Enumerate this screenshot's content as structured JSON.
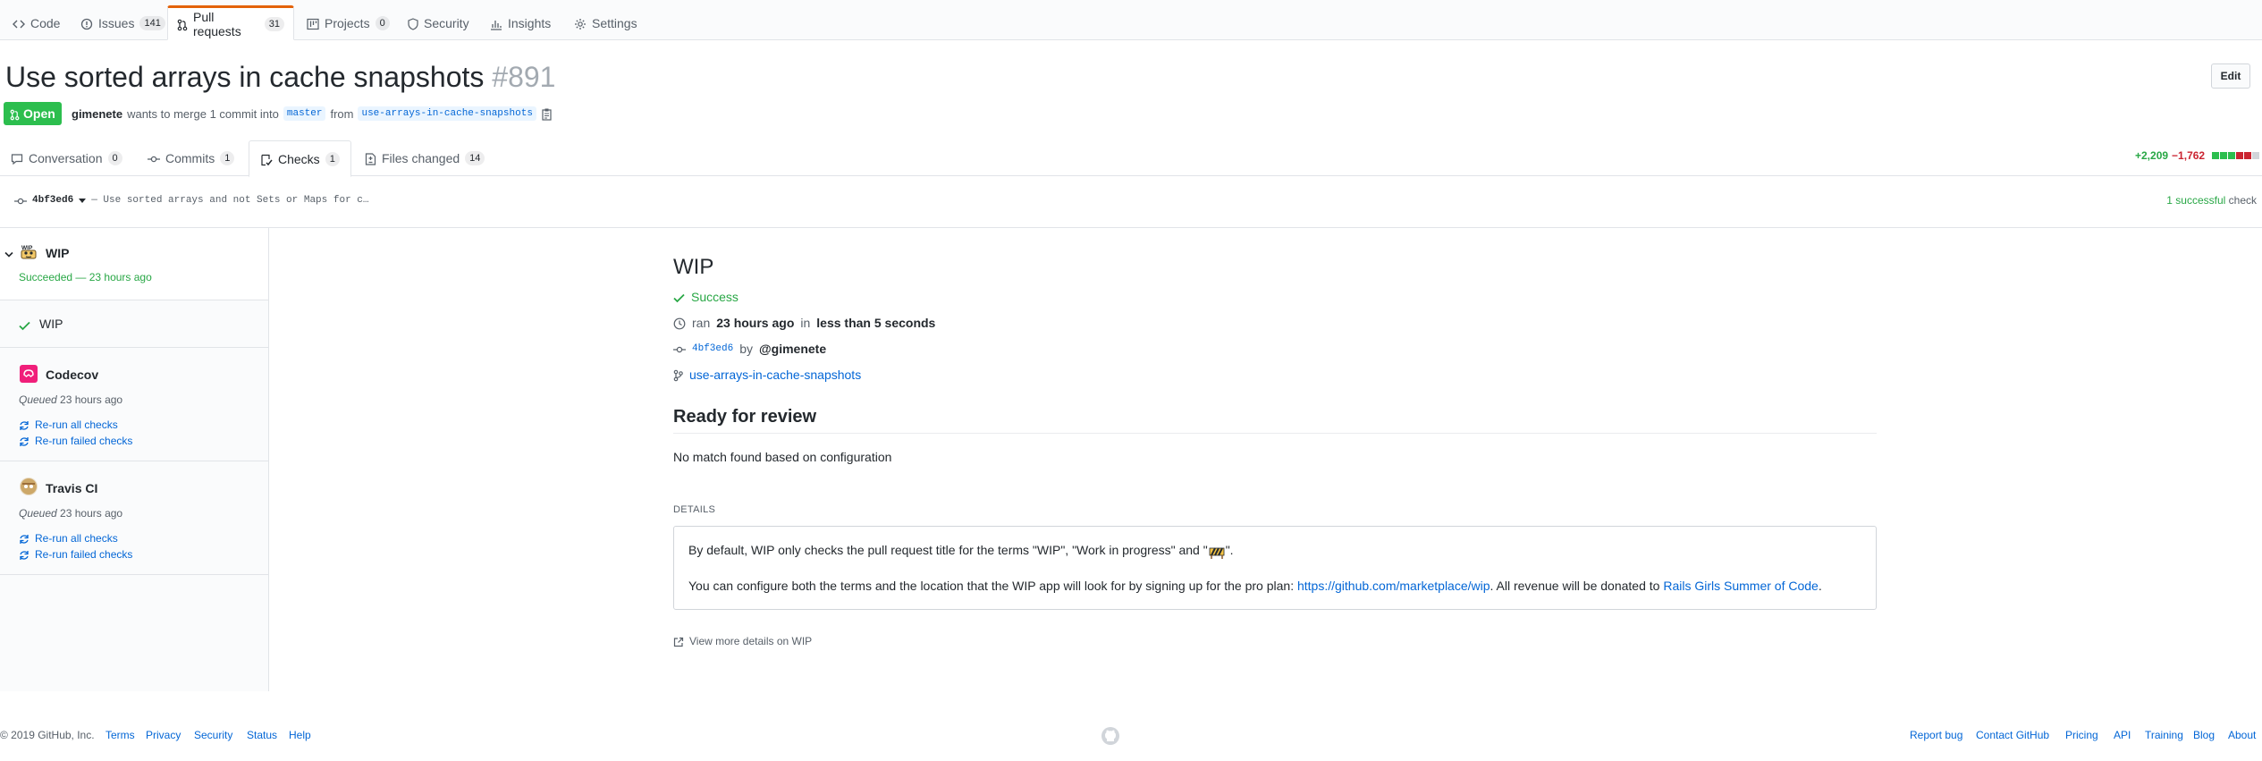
{
  "reponav": {
    "items": [
      {
        "label": "Code",
        "icon": "code-icon"
      },
      {
        "label": "Issues",
        "count": "141",
        "icon": "issue-icon"
      },
      {
        "label": "Pull requests",
        "count": "31",
        "icon": "pull-request-icon",
        "selected": true
      },
      {
        "label": "Projects",
        "count": "0",
        "icon": "project-icon"
      },
      {
        "label": "Security",
        "icon": "shield-icon"
      },
      {
        "label": "Insights",
        "icon": "graph-icon"
      },
      {
        "label": "Settings",
        "icon": "gear-icon"
      }
    ]
  },
  "pr": {
    "title": "Use sorted arrays in cache snapshots",
    "number": "#891",
    "edit_label": "Edit",
    "state": "Open",
    "author": "gimenete",
    "merge_text_1": "wants to merge 1 commit into",
    "base_ref": "master",
    "from_text": "from",
    "head_ref": "use-arrays-in-cache-snapshots"
  },
  "tabs": [
    {
      "label": "Conversation",
      "count": "0",
      "icon": "comment-icon"
    },
    {
      "label": "Commits",
      "count": "1",
      "icon": "commit-icon"
    },
    {
      "label": "Checks",
      "count": "1",
      "icon": "checklist-icon",
      "selected": true
    },
    {
      "label": "Files changed",
      "count": "14",
      "icon": "file-diff-icon"
    }
  ],
  "diffstat": {
    "additions": "+2,209",
    "deletions": "−1,762",
    "colors": {
      "add": "#2cbe4e",
      "del": "#cb2431",
      "neutral": "#d1d5da"
    }
  },
  "commit": {
    "sha": "4bf3ed6",
    "message": "— Use sorted arrays and not Sets or Maps for c…",
    "checks_ok": "1 successful",
    "checks_word": "check"
  },
  "sidebar": {
    "suites": [
      {
        "name": "WIP",
        "status": "Succeeded — 23 hours ago",
        "check_run": "WIP"
      },
      {
        "name": "Codecov",
        "status_prefix": "Queued",
        "status_time": "23 hours ago",
        "rerun_all": "Re-run all checks",
        "rerun_failed": "Re-run failed checks"
      },
      {
        "name": "Travis CI",
        "status_prefix": "Queued",
        "status_time": "23 hours ago",
        "rerun_all": "Re-run all checks",
        "rerun_failed": "Re-run failed checks"
      }
    ]
  },
  "check": {
    "title": "WIP",
    "status": "Success",
    "ran_prefix": "ran",
    "ran_time": "23 hours ago",
    "ran_in": "in",
    "ran_duration": "less than 5 seconds",
    "sha": "4bf3ed6",
    "by": "by",
    "actor": "@gimenete",
    "branch": "use-arrays-in-cache-snapshots",
    "summary_title": "Ready for review",
    "summary_text": "No match found based on configuration",
    "details_label": "DETAILS",
    "details_p1_a": "By default, WIP only checks the pull request title for the terms \"WIP\", \"Work in progress\" and \"",
    "details_p1_b": "\".",
    "details_p2_a": "You can configure both the terms and the location that the WIP app will look for by signing up for the pro plan: ",
    "details_p2_link": "https://github.com/marketplace/wip",
    "details_p2_b": ". All revenue will be donated to ",
    "details_p2_link2": "Rails Girls Summer of Code",
    "details_p2_c": ".",
    "more_link": "View more details on WIP"
  },
  "footer": {
    "copyright": "© 2019 GitHub, Inc.",
    "left_links": [
      "Terms",
      "Privacy",
      "Security",
      "Status",
      "Help"
    ],
    "right_links": [
      "Report bug",
      "Contact GitHub",
      "Pricing",
      "API",
      "Training",
      "Blog",
      "About"
    ]
  }
}
